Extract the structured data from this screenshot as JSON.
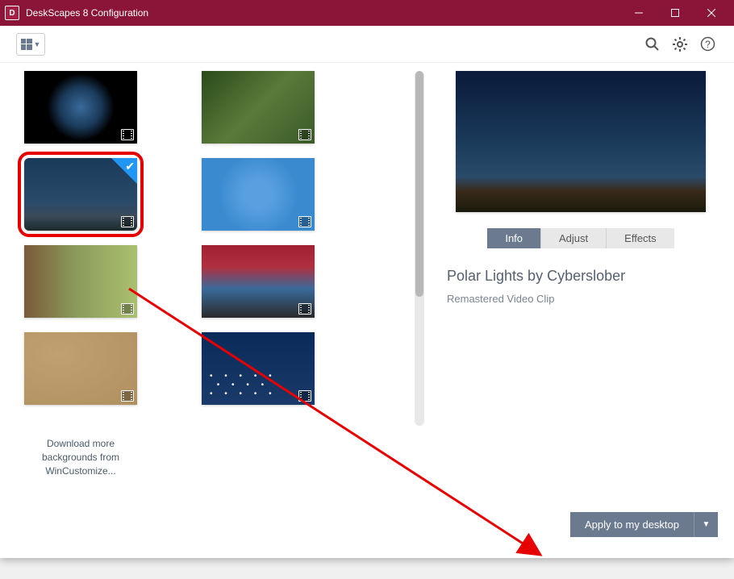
{
  "window": {
    "title": "DeskScapes 8 Configuration",
    "icon_letter": "D"
  },
  "toolbar": {
    "view_name": "grid-view",
    "search_name": "search",
    "settings_name": "settings",
    "help_name": "help"
  },
  "gallery": {
    "download_text_line1": "Download more",
    "download_text_line2": "backgrounds from",
    "download_text_line3": "WinCustomize...",
    "thumbs": [
      {
        "name": "earth",
        "selected": false
      },
      {
        "name": "forest",
        "selected": false
      },
      {
        "name": "polar-lights",
        "selected": true
      },
      {
        "name": "blue-rings",
        "selected": false
      },
      {
        "name": "tree-bark",
        "selected": false
      },
      {
        "name": "red-car",
        "selected": false
      },
      {
        "name": "sand-ripples",
        "selected": false
      },
      {
        "name": "snowfall",
        "selected": false
      }
    ]
  },
  "preview": {
    "tabs": [
      {
        "label": "Info",
        "active": true
      },
      {
        "label": "Adjust",
        "active": false
      },
      {
        "label": "Effects",
        "active": false
      }
    ],
    "title": "Polar Lights by Cyberslober",
    "subtitle": "Remastered Video Clip",
    "apply_label": "Apply to my desktop",
    "apply_drop": "▼"
  },
  "annotation": {
    "arrow_from": "selected-thumbnail",
    "arrow_to": "apply-button",
    "color": "#e60000"
  }
}
